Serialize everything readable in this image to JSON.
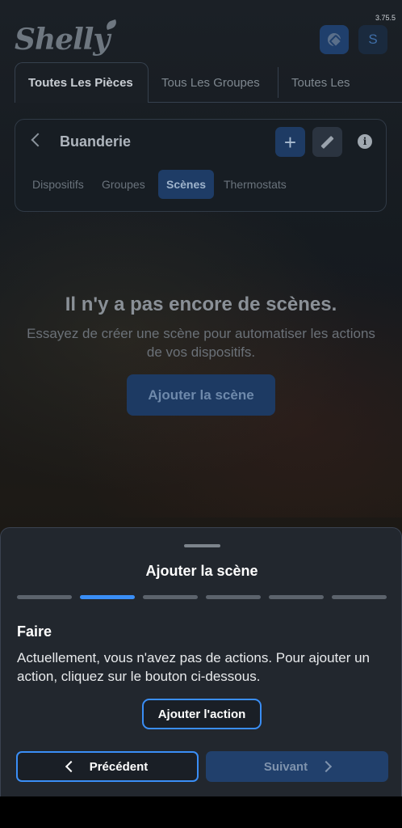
{
  "status": {
    "version": "3.75.5"
  },
  "header": {
    "logo_text": "Shelly",
    "avatar_letter": "S"
  },
  "tabs": [
    {
      "label": "Toutes Les Pièces",
      "active": true
    },
    {
      "label": "Tous Les Groupes",
      "active": false
    },
    {
      "label": "Toutes Les",
      "active": false
    }
  ],
  "room": {
    "title": "Buanderie",
    "add_icon": "+",
    "info_icon": "i",
    "subtabs": [
      {
        "label": "Dispositifs",
        "active": false
      },
      {
        "label": "Groupes",
        "active": false
      },
      {
        "label": "Scènes",
        "active": true
      },
      {
        "label": "Thermostats",
        "active": false
      }
    ]
  },
  "empty_state": {
    "title": "Il n'y a pas encore de scènes.",
    "description": "Essayez de créer une scène pour automatiser les actions de vos dispositifs.",
    "button_label": "Ajouter la scène"
  },
  "sheet": {
    "title": "Ajouter la scène",
    "steps_total": 6,
    "active_step": 2,
    "step_label": "Faire",
    "step_description": "Actuellement, vous n'avez pas de actions. Pour ajouter un action, cliquez sur le bouton ci-dessous.",
    "add_action_label": "Ajouter l'action",
    "prev_label": "Précédent",
    "next_label": "Suivant"
  },
  "colors": {
    "accent": "#3a8ef6",
    "sheet_bg": "#22272e",
    "disabled_button": "#21406c"
  }
}
